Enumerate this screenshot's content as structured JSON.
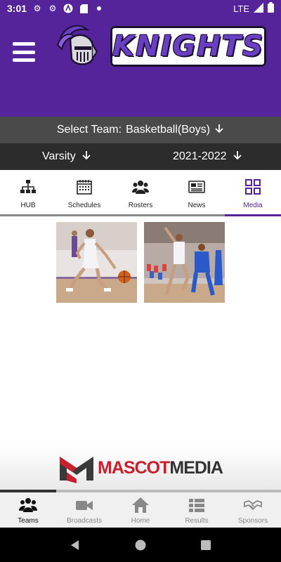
{
  "status_bar": {
    "time": "3:01",
    "network": "LTE",
    "icons": [
      "gear-icon",
      "gear-icon",
      "app-icon",
      "sd-card-icon",
      "dot-icon",
      "signal-icon",
      "battery-icon"
    ]
  },
  "header": {
    "brand_wordmark": "KNIGHTS",
    "colors": {
      "primary": "#55249a",
      "accent": "#6a3fc4"
    }
  },
  "team_selector": {
    "label": "Select Team:",
    "value": "Basketball(Boys)"
  },
  "level_selector": {
    "value": "Varsity"
  },
  "season_selector": {
    "value": "2021-2022"
  },
  "tabs": [
    {
      "label": "HUB",
      "icon": "hierarchy-icon"
    },
    {
      "label": "Schedules",
      "icon": "calendar-icon"
    },
    {
      "label": "Rosters",
      "icon": "people-icon"
    },
    {
      "label": "News",
      "icon": "newspaper-icon"
    },
    {
      "label": "Media",
      "icon": "grid-icon",
      "active": true
    }
  ],
  "media": {
    "items": [
      {
        "caption": "",
        "icon": "photo-dribble"
      },
      {
        "caption": "",
        "icon": "photo-layup"
      }
    ]
  },
  "sponsor": {
    "brand_part1": "MASCOT",
    "brand_part2": "MEDIA"
  },
  "bottom_nav": [
    {
      "label": "Teams",
      "icon": "people-icon",
      "active": true
    },
    {
      "label": "Broadcasts",
      "icon": "video-camera-icon"
    },
    {
      "label": "Home",
      "icon": "home-icon"
    },
    {
      "label": "Results",
      "icon": "list-icon"
    },
    {
      "label": "Sponsors",
      "icon": "handshake-icon"
    }
  ],
  "ad_progress": 0.2
}
